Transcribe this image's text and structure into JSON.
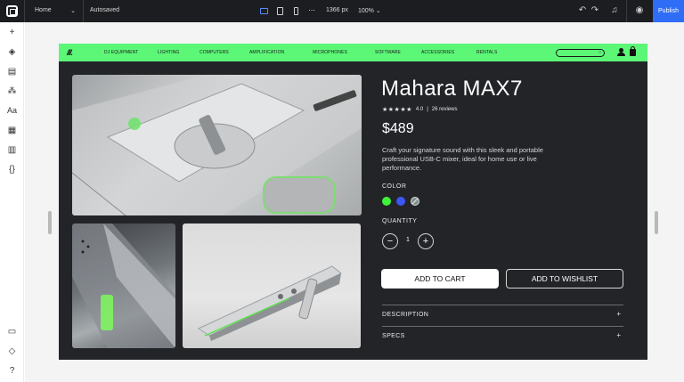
{
  "editor": {
    "page_select": "Home",
    "save_status": "Autosaved",
    "canvas_width": "1366 px",
    "zoom": "100%",
    "publish_label": "Publish",
    "more_label": "···",
    "chevron": "⌄"
  },
  "left_rail": {
    "icons": [
      "plus-icon",
      "layers-icon",
      "pages-icon",
      "components-icon",
      "typography-icon",
      "apps-icon",
      "cms-icon",
      "code-icon",
      "comments-icon",
      "learn-icon",
      "help-icon"
    ]
  },
  "site": {
    "accent": "#5cf777",
    "brand": "///.",
    "nav": [
      "DJ EQUIPMENT",
      "LIGHTING",
      "COMPUTERS",
      "AMPLIFICATION",
      "MICROPHONES",
      "SOFTWARE",
      "ACCESSORIES",
      "RENTALS"
    ]
  },
  "product": {
    "title": "Mahara MAX7",
    "stars": "★★★★★",
    "rating": "4.0",
    "reviews": "26 reviews",
    "rating_sep": "|",
    "price": "$489",
    "description": "Craft your signature sound with this sleek and portable professional USB-C mixer, ideal for home use or live performance.",
    "color_label": "COLOR",
    "colors": [
      "#3ff23a",
      "#3d57f5",
      "#7d8e89"
    ],
    "quantity_label": "QUANTITY",
    "quantity": "1",
    "minus": "−",
    "plus": "+",
    "add_to_cart": "ADD TO CART",
    "add_to_wishlist": "ADD TO WISHLIST",
    "accordions": [
      {
        "label": "DESCRIPTION",
        "toggle": "+"
      },
      {
        "label": "SPECS",
        "toggle": "+"
      }
    ]
  }
}
